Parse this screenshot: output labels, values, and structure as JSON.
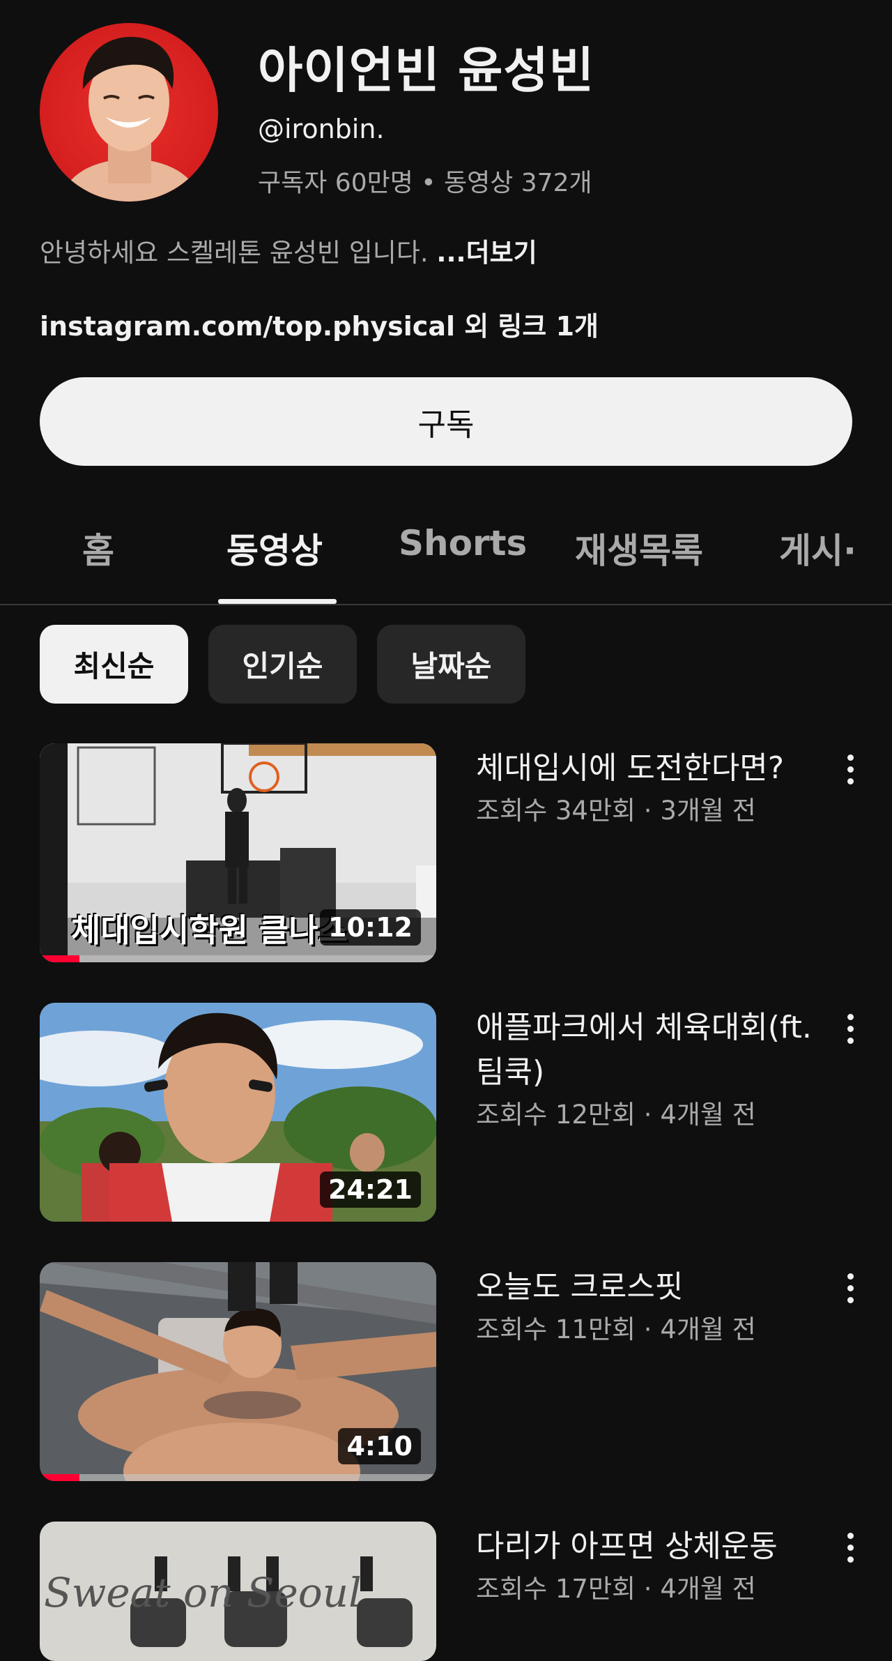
{
  "channel": {
    "name": "아이언빈 윤성빈",
    "handle": "@ironbin.",
    "stats": "구독자 60만명 • 동영상 372개",
    "description": "안녕하세요 스켈레톤 윤성빈 입니다. ",
    "more_label": "...더보기",
    "link_text": "instagram.com/top.physical",
    "link_extra": " 외 링크 1개",
    "subscribe_label": "구독"
  },
  "tabs": [
    {
      "label": "홈"
    },
    {
      "label": "동영상"
    },
    {
      "label": "Shorts"
    },
    {
      "label": "재생목록"
    },
    {
      "label": "게시·"
    }
  ],
  "active_tab": "동영상",
  "chips": [
    {
      "label": "최신순"
    },
    {
      "label": "인기순"
    },
    {
      "label": "날짜순"
    }
  ],
  "active_chip": "최신순",
  "videos": [
    {
      "title": "체대입시에 도전한다면?",
      "meta": "조회수 34만회 · 3개월 전",
      "duration": "10:12",
      "thumb_caption": "체대입시학원 클나스",
      "watched_fraction": 0.1
    },
    {
      "title": "애플파크에서 체육대회(ft.팀쿡)",
      "meta": "조회수 12만회 · 4개월 전",
      "duration": "24:21"
    },
    {
      "title": "오늘도 크로스핏",
      "meta": "조회수 11만회 · 4개월 전",
      "duration": "4:10",
      "watched_fraction": 0.1
    },
    {
      "title": "다리가 아프면 상체운동",
      "meta": "조회수 17만회 · 4개월 전",
      "thumb_caption": "Sweat on Seoul"
    }
  ],
  "colors": {
    "background": "#0f0f0f",
    "text_primary": "#f1f1f1",
    "text_secondary": "#aaaaaa",
    "progress": "#ff0033",
    "chip_bg": "#272727"
  }
}
